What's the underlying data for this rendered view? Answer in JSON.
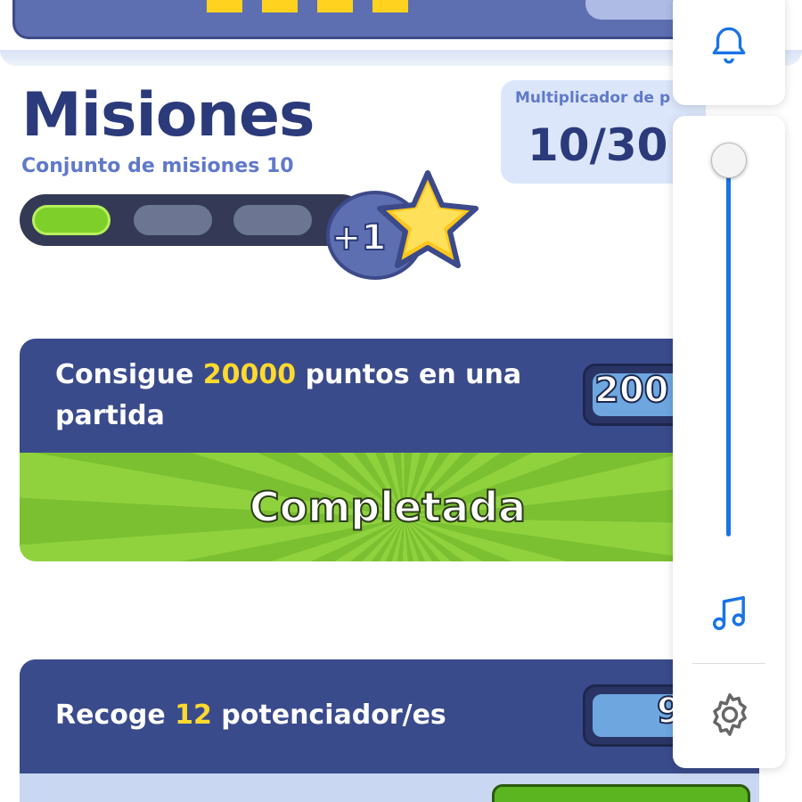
{
  "header": {
    "title": "Misiones",
    "subtitle": "Conjunto de misiones 10",
    "partial_number": "1",
    "progress": {
      "completed": 1,
      "total": 3
    },
    "reward_badge": "+1"
  },
  "multiplier": {
    "label": "Multiplicador de p",
    "value": "10/30"
  },
  "missions": [
    {
      "text_before": "Consigue ",
      "highlight": "20000",
      "text_after": " puntos en una",
      "text_line2": "partida",
      "counter": "200",
      "status": "Completada"
    },
    {
      "text_before": "Recoge ",
      "highlight": "12",
      "text_after": " potenciador/es",
      "counter": "9"
    }
  ],
  "controls": {
    "bell": "bell-icon",
    "volume_level": 1.0,
    "music": "music-note-icon",
    "settings": "gear-icon"
  },
  "colors": {
    "title": "#2b3a7a",
    "accent_yellow": "#ffd92e",
    "card_header": "#3a4b8c",
    "complete_green": "#7bc030",
    "slider_blue": "#1a73e8"
  }
}
